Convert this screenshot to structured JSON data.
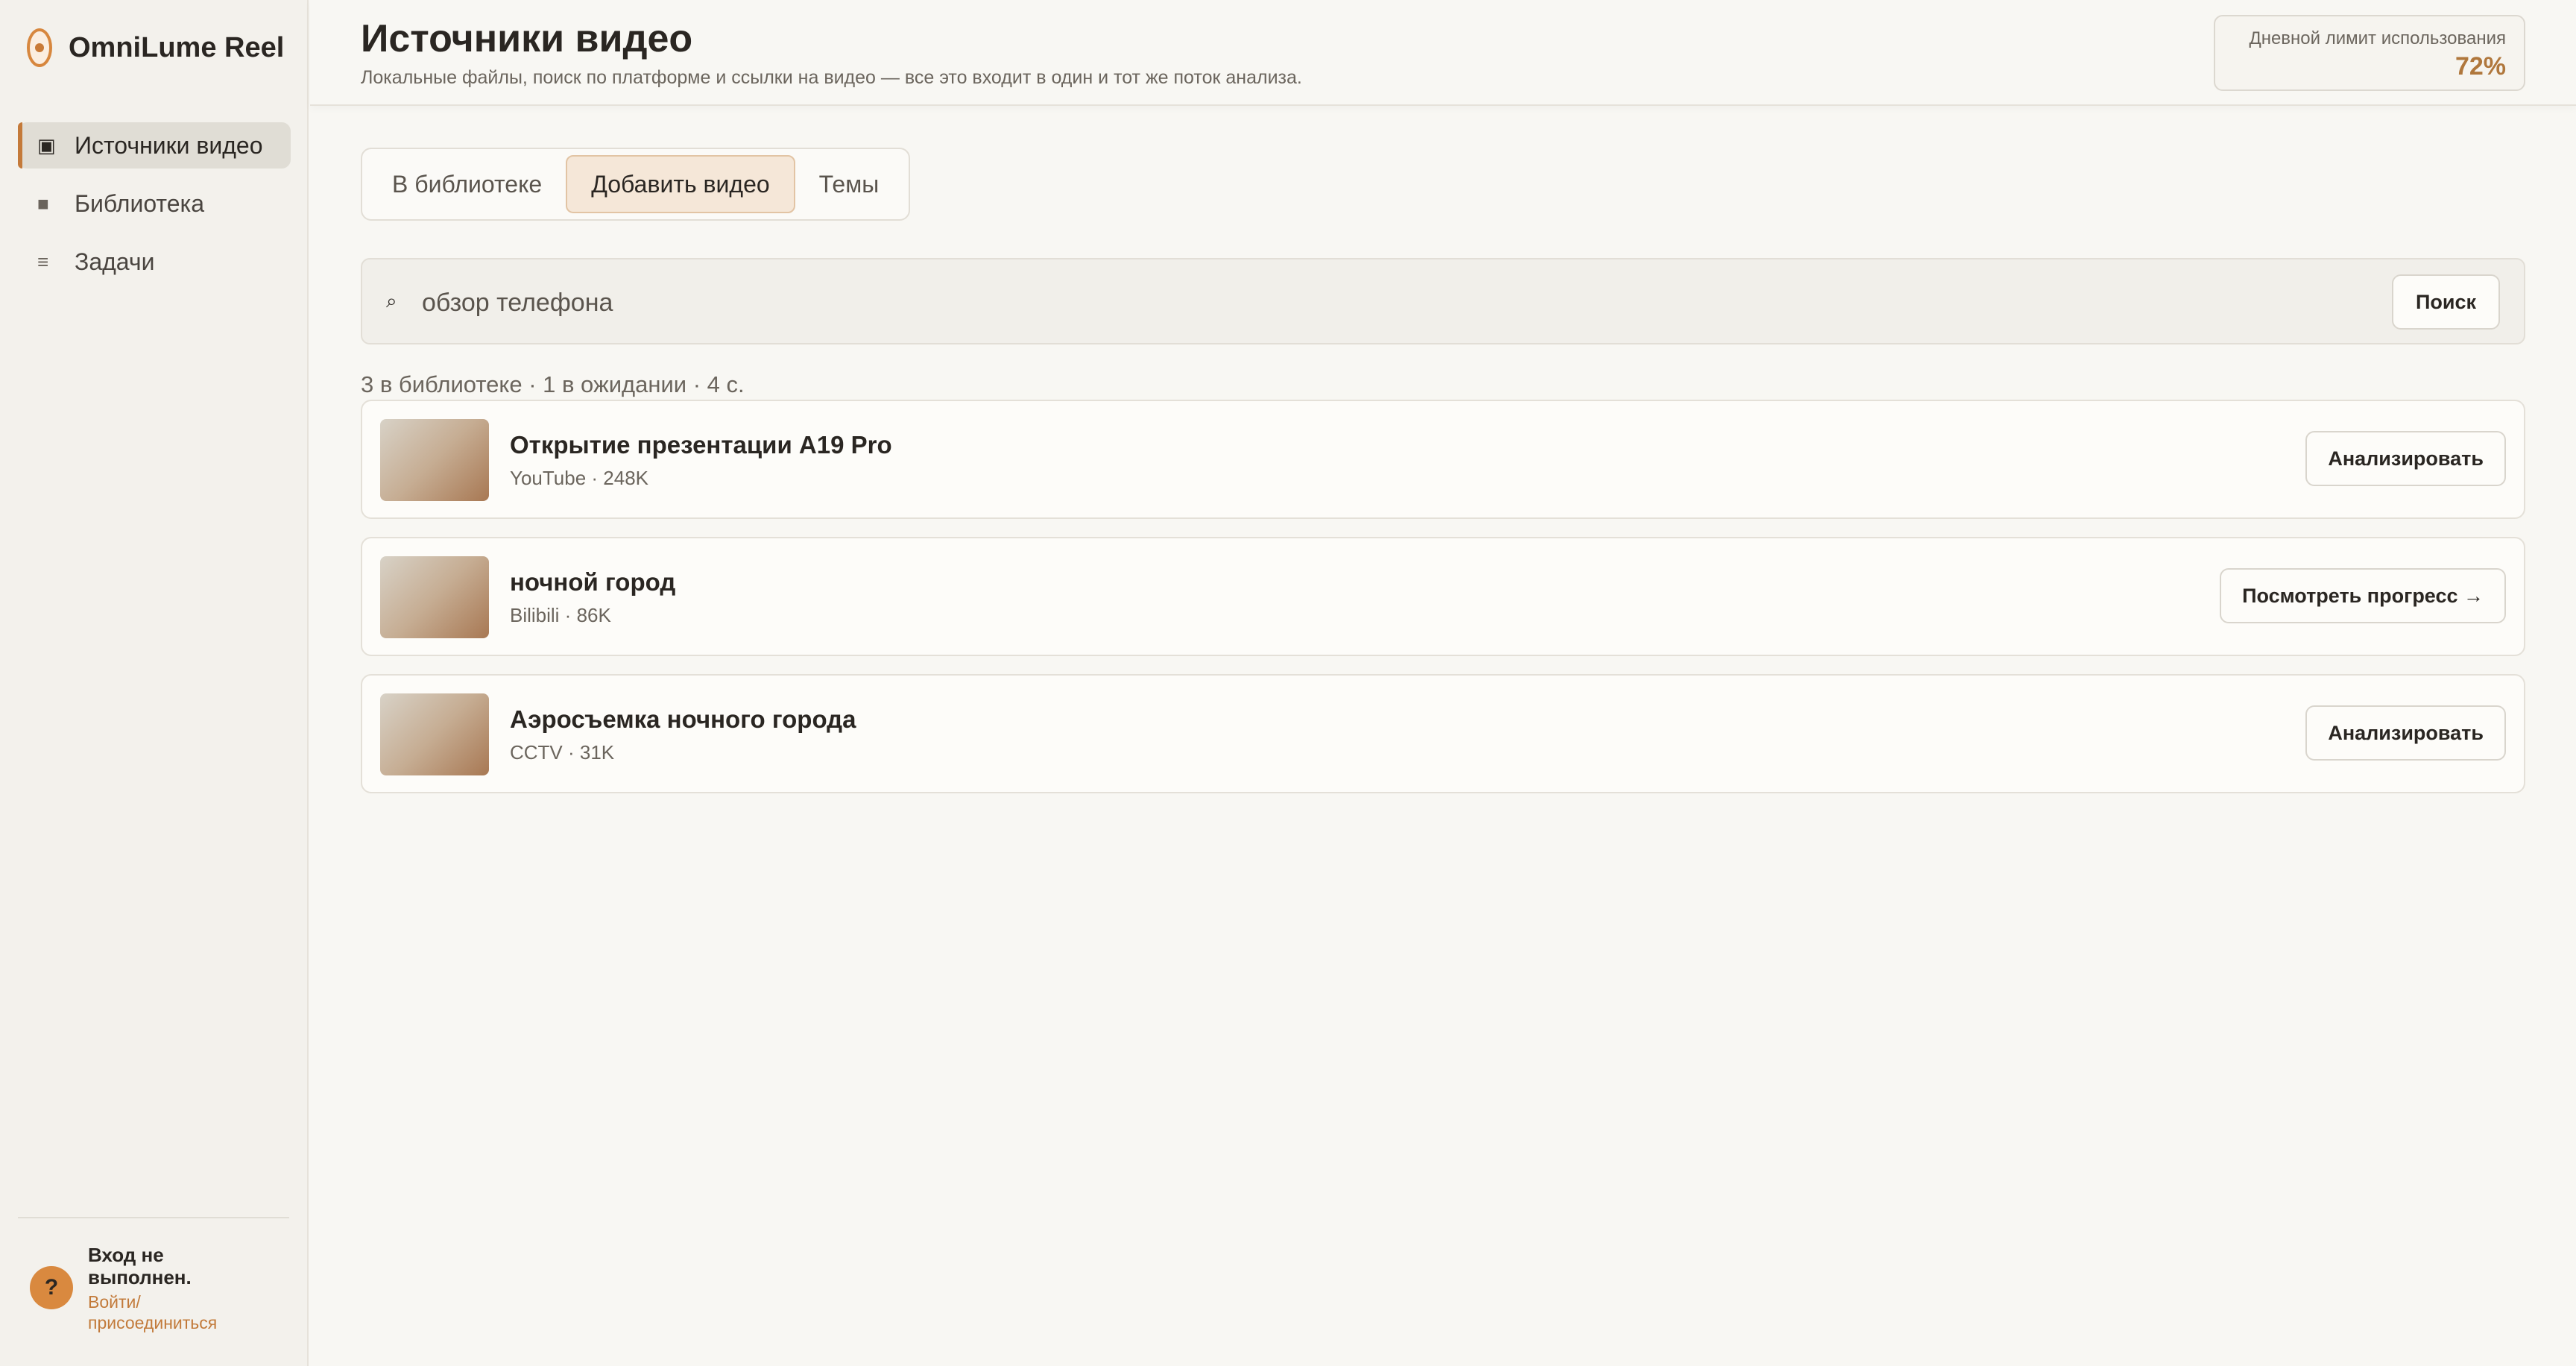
{
  "app": {
    "name": "OmniLume Reel"
  },
  "sidebar": {
    "items": [
      {
        "label": "Источники видео",
        "icon": "video-source-icon",
        "glyph": "▣",
        "active": true
      },
      {
        "label": "Библиотека",
        "icon": "library-icon",
        "glyph": "■",
        "active": false
      },
      {
        "label": "Задачи",
        "icon": "tasks-icon",
        "glyph": "≡",
        "active": false
      }
    ]
  },
  "user": {
    "avatar": "?",
    "status": "Вход не выполнен.",
    "link": "Войти/ присоединиться"
  },
  "header": {
    "title": "Источники видео",
    "subtitle": "Локальные файлы, поиск по платформе и ссылки на видео — все это входит в один и тот же поток анализа.",
    "quota_label": "Дневной лимит использования",
    "quota_value": "72%"
  },
  "tabs": [
    {
      "label": "В библиотеке",
      "active": false
    },
    {
      "label": "Добавить видео",
      "active": true
    },
    {
      "label": "Темы",
      "active": false
    }
  ],
  "search": {
    "icon_glyph": "⌕",
    "value": "обзор телефона",
    "button_label": "Поиск"
  },
  "stats": "3 в библиотеке · 1 в ожидании · 4 с.",
  "results": [
    {
      "title": "Открытие презентации A19 Pro",
      "meta": "YouTube · 248K",
      "action": "Анализировать"
    },
    {
      "title": "ночной город",
      "meta": "Bilibili · 86K",
      "action": "Посмотреть прогресс →"
    },
    {
      "title": "Аэросъемка ночного города",
      "meta": "CCTV · 31K",
      "action": "Анализировать"
    }
  ],
  "colors": {
    "accent": "#c47a3a",
    "quota": "#b0773c",
    "background": "#f8f7f3"
  }
}
